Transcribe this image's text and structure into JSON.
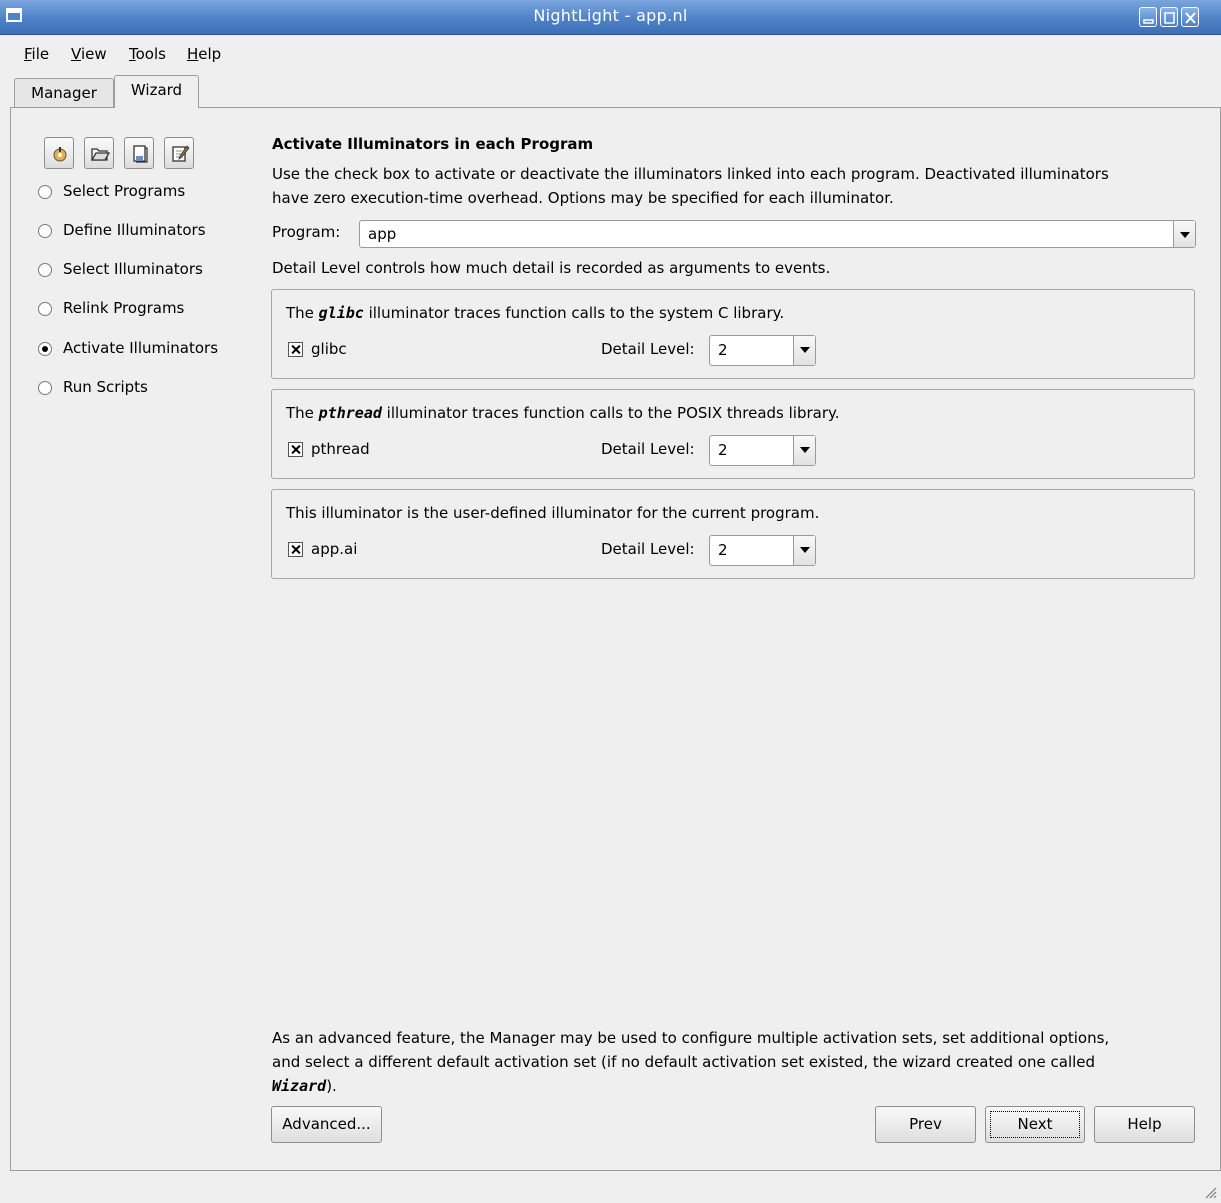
{
  "window": {
    "title": "NightLight - app.nl"
  },
  "menu": [
    {
      "label": "File"
    },
    {
      "label": "View"
    },
    {
      "label": "Tools"
    },
    {
      "label": "Help"
    }
  ],
  "tabs": [
    {
      "label": "Manager",
      "active": false
    },
    {
      "label": "Wizard",
      "active": true
    }
  ],
  "toolbar": {
    "icons": [
      "new-icon",
      "open-folder-icon",
      "save-icon",
      "edit-icon"
    ]
  },
  "steps": [
    {
      "label": "Select Programs",
      "selected": false
    },
    {
      "label": "Define Illuminators",
      "selected": false
    },
    {
      "label": "Select Illuminators",
      "selected": false
    },
    {
      "label": "Relink Programs",
      "selected": false
    },
    {
      "label": "Activate Illuminators",
      "selected": true
    },
    {
      "label": "Run Scripts",
      "selected": false
    }
  ],
  "main": {
    "heading": "Activate Illuminators in each Program",
    "intro_line1": "Use the check box to activate or deactivate the illuminators linked into each program. Deactivated illuminators",
    "intro_line2": "have zero execution-time overhead. Options may be specified for each illuminator.",
    "program_label": "Program:",
    "program_value": "app",
    "detail_note": "Detail Level controls how much detail is recorded as arguments to events.",
    "illuminators": [
      {
        "desc_pre": "The ",
        "desc_name": "glibc",
        "desc_post": " illuminator traces function calls to the system C library.",
        "checked": true,
        "name": "glibc",
        "detail_label": "Detail Level:",
        "detail_value": "2"
      },
      {
        "desc_pre": "The ",
        "desc_name": "pthread",
        "desc_post": " illuminator traces function calls to the POSIX threads library.",
        "checked": true,
        "name": "pthread",
        "detail_label": "Detail Level:",
        "detail_value": "2"
      },
      {
        "desc_pre": "This illuminator is the user-defined illuminator for the current program.",
        "desc_name": "",
        "desc_post": "",
        "checked": true,
        "name": "app.ai",
        "detail_label": "Detail Level:",
        "detail_value": "2"
      }
    ],
    "footer_line1": "As an advanced feature, the Manager may be used to configure multiple activation sets, set additional options,",
    "footer_line2": "and select a different default activation set (if no default activation set existed, the wizard created one called",
    "footer_line3_name": "Wizard",
    "footer_line3_post": ")."
  },
  "buttons": {
    "advanced": "Advanced...",
    "prev": "Prev",
    "next": "Next",
    "help": "Help"
  }
}
